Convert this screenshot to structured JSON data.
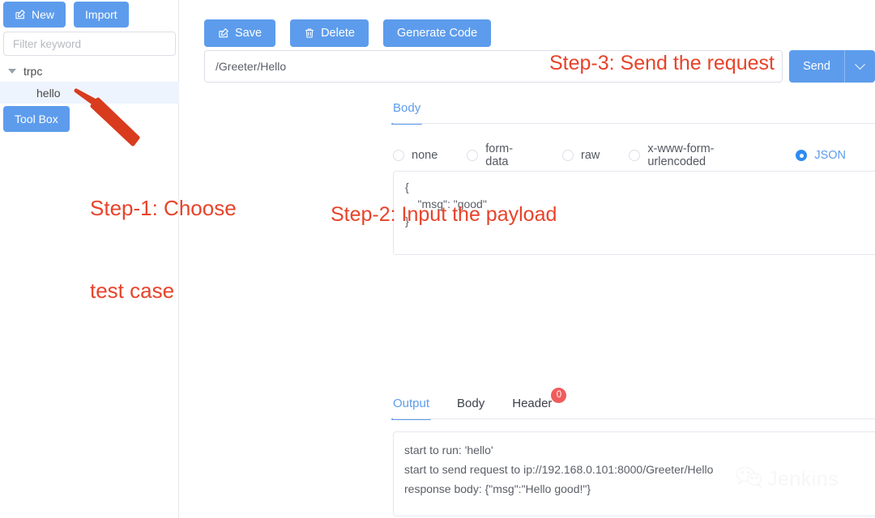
{
  "sidebar": {
    "new_button": "New",
    "import_button": "Import",
    "filter_placeholder": "Filter keyword",
    "filter_value": "",
    "toolbox_button": "Tool Box",
    "tree": [
      {
        "label": "trpc",
        "level": 0,
        "expanded": true,
        "selected": false
      },
      {
        "label": "hello",
        "level": 1,
        "expanded": false,
        "selected": true
      }
    ]
  },
  "toolbar": {
    "save_label": "Save",
    "delete_label": "Delete",
    "generate_code_label": "Generate Code"
  },
  "request": {
    "url_value": "/Greeter/Hello",
    "url_placeholder": "",
    "send_label": "Send"
  },
  "body_section": {
    "tabs": [
      {
        "label": "Body",
        "active": true
      }
    ],
    "content_types": [
      {
        "label": "none",
        "checked": false
      },
      {
        "label": "form-data",
        "checked": false
      },
      {
        "label": "raw",
        "checked": false
      },
      {
        "label": "x-www-form-urlencoded",
        "checked": false
      },
      {
        "label": "JSON",
        "checked": true
      }
    ],
    "payload": "{\n    \"msg\": \"good\"\n}"
  },
  "output_section": {
    "tabs": [
      {
        "label": "Output",
        "active": true,
        "badge": ""
      },
      {
        "label": "Body",
        "active": false,
        "badge": ""
      },
      {
        "label": "Header",
        "active": false,
        "badge": "0"
      }
    ],
    "log_lines": [
      "start to run: 'hello'",
      "start to send request to ip://192.168.0.101:8000/Greeter/Hello",
      "response body: {\"msg\":\"Hello good!\"}"
    ]
  },
  "annotations": {
    "step1_line1": "Step-1: Choose",
    "step1_line2": "test case",
    "step2": "Step-2: Input the payload",
    "step3": "Step-3: Send the request",
    "color": "#e8432a"
  },
  "watermark": {
    "text": "Jenkins"
  },
  "colors": {
    "primary": "#5d9cec",
    "radio_active": "#2e8bf2",
    "badge": "#f15b5b",
    "tab_active": "#5d9cec",
    "selected_row": "#eef4fe"
  }
}
